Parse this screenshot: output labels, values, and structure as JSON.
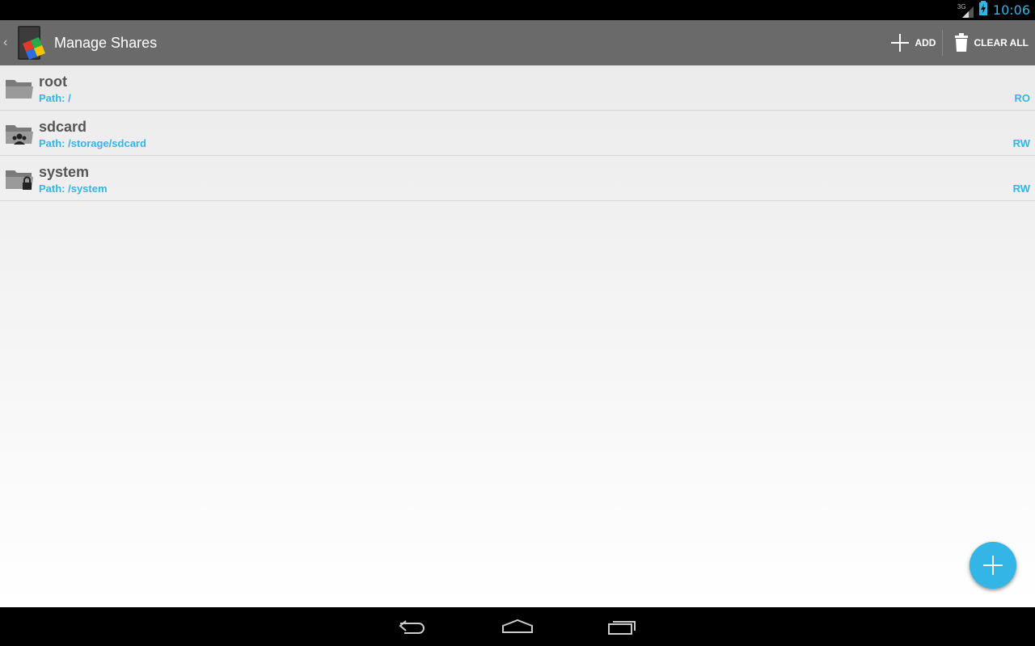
{
  "status": {
    "network": "3G",
    "time": "10:06"
  },
  "actionbar": {
    "title": "Manage Shares",
    "add_label": "ADD",
    "clear_label": "CLEAR ALL"
  },
  "shares": [
    {
      "name": "root",
      "path": "Path: /",
      "mode": "RO",
      "icon": "folder-icon"
    },
    {
      "name": "sdcard",
      "path": "Path: /storage/sdcard",
      "mode": "RW",
      "icon": "shared-folder-icon"
    },
    {
      "name": "system",
      "path": "Path: /system",
      "mode": "RW",
      "icon": "locked-folder-icon"
    }
  ],
  "colors": {
    "accent": "#33b5e5",
    "actionbar": "#6a6a6a",
    "text": "#555555"
  }
}
